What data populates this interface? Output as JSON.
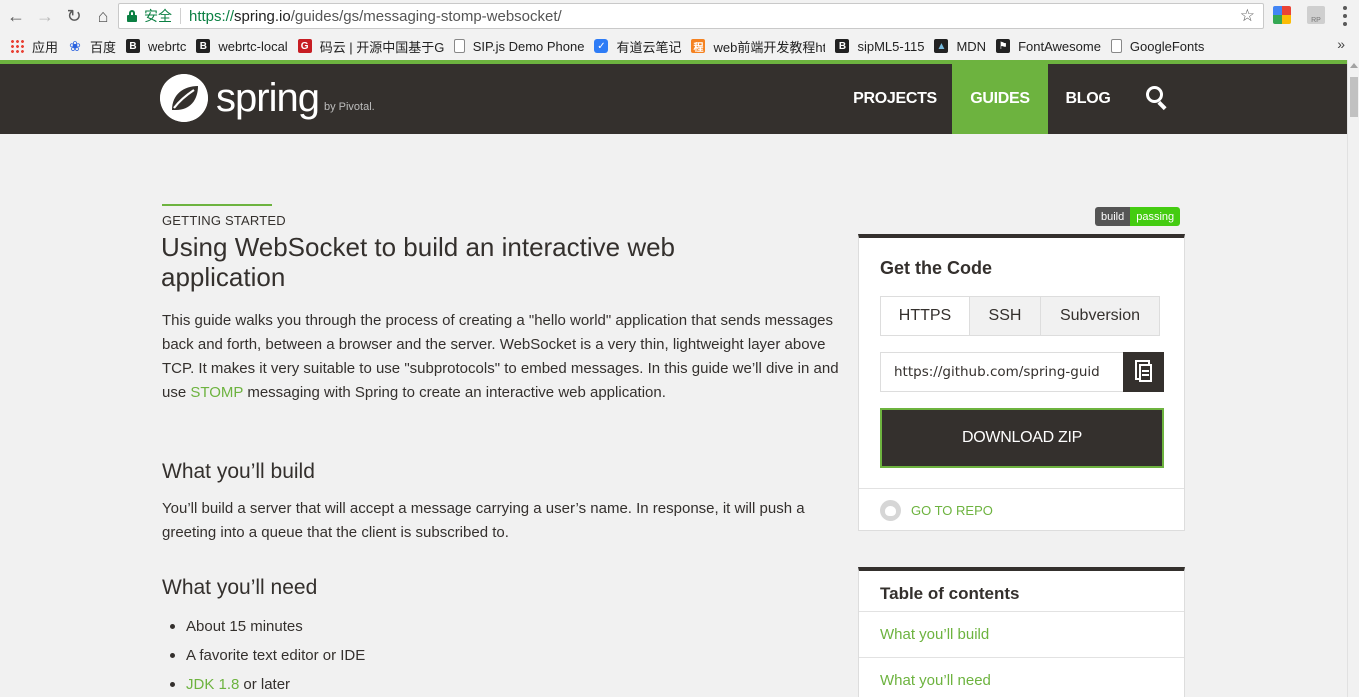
{
  "browser": {
    "secure_label": "安全",
    "url_scheme": "https://",
    "url_host": "spring.io",
    "url_path": "/guides/gs/messaging-stomp-websocket/",
    "ext2_label": "RP"
  },
  "bookmarks": [
    {
      "label": "应用",
      "icon": "apps-grid-icon"
    },
    {
      "label": "百度",
      "icon": "baidu-paw-icon"
    },
    {
      "label": "webrtc",
      "icon": "b-icon"
    },
    {
      "label": "webrtc-local",
      "icon": "b-icon"
    },
    {
      "label": "码云 | 开源中国基于G",
      "icon": "gitee-icon"
    },
    {
      "label": "SIP.js Demo Phone",
      "icon": "page-icon"
    },
    {
      "label": "有道云笔记",
      "icon": "youdao-icon"
    },
    {
      "label": "web前端开发教程htm",
      "icon": "tutorial-icon"
    },
    {
      "label": "sipML5-115",
      "icon": "b-icon"
    },
    {
      "label": "MDN",
      "icon": "mdn-icon"
    },
    {
      "label": "FontAwesome",
      "icon": "flag-icon"
    },
    {
      "label": "GoogleFonts",
      "icon": "page-icon"
    }
  ],
  "bookmarks_more": "»",
  "header": {
    "logo_text": "spring",
    "logo_by": "by Pivotal.",
    "nav": {
      "projects": "PROJECTS",
      "guides": "GUIDES",
      "blog": "BLOG"
    },
    "accent_color": "#6db33f",
    "bg_color": "#34302d"
  },
  "main": {
    "eyebrow": "GETTING STARTED",
    "title": "Using WebSocket to build an interactive web application",
    "intro_before": "This guide walks you through the process of creating a \"hello world\" application that sends messages back and forth, between a browser and the server. WebSocket is a very thin, lightweight layer above TCP. It makes it very suitable to use \"subprotocols\" to embed messages. In this guide we’ll dive in and use ",
    "intro_link": "STOMP",
    "intro_after": " messaging with Spring to create an interactive web application.",
    "build_heading": "What you’ll build",
    "build_text": "You’ll build a server that will accept a message carrying a user’s name. In response, it will push a greeting into a queue that the client is subscribed to.",
    "need_heading": "What you’ll need",
    "need_items": [
      {
        "text": "About 15 minutes"
      },
      {
        "text": "A favorite text editor or IDE"
      },
      {
        "link": "JDK 1.8",
        "text": "or later"
      }
    ]
  },
  "sidebar": {
    "badge_left": "build",
    "badge_right": "passing",
    "code_title": "Get the Code",
    "tabs": [
      "HTTPS",
      "SSH",
      "Subversion"
    ],
    "clone_url": "https://github.com/spring-guid",
    "download_label": "DOWNLOAD ZIP",
    "repo_label": "GO TO REPO",
    "toc_title": "Table of contents",
    "toc_items": [
      "What you’ll build",
      "What you’ll need"
    ]
  }
}
